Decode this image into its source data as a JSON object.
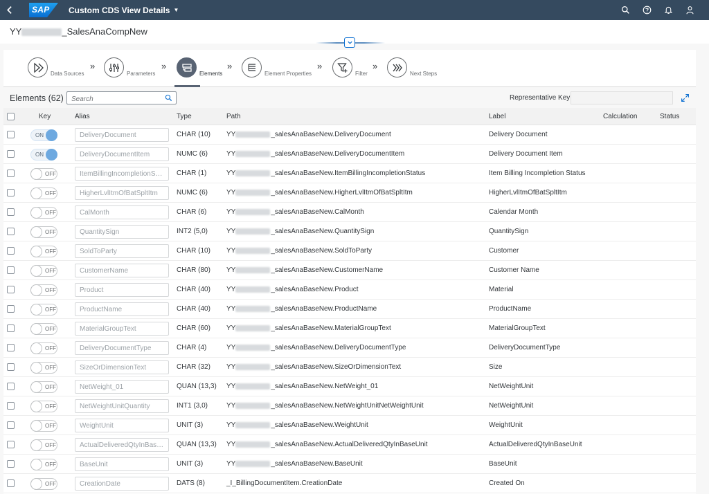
{
  "shell": {
    "logo": "SAP",
    "title": "Custom CDS View Details"
  },
  "header": {
    "title_prefix": "YY",
    "title_suffix": "_SalesAnaCompNew"
  },
  "wizard": {
    "steps": [
      {
        "label": "Data Sources",
        "icon": "data-sources-icon"
      },
      {
        "label": "Parameters",
        "icon": "parameters-icon"
      },
      {
        "label": "Elements",
        "icon": "elements-icon",
        "active": true
      },
      {
        "label": "Element Properties",
        "icon": "element-properties-icon"
      },
      {
        "label": "Filter",
        "icon": "filter-icon"
      },
      {
        "label": "Next Steps",
        "icon": "next-steps-icon"
      }
    ]
  },
  "toolbar": {
    "title": "Elements (62)",
    "search_placeholder": "Search",
    "representative_key_label": "Representative Key"
  },
  "table": {
    "columns": [
      "Key",
      "Alias",
      "Type",
      "Path",
      "Label",
      "Calculation",
      "Status"
    ],
    "toggle_on": "ON",
    "toggle_off": "OFF",
    "rows": [
      {
        "key": true,
        "alias": "DeliveryDocument",
        "type": "CHAR (10)",
        "path_prefix": "YY",
        "path": "_salesAnaBaseNew.DeliveryDocument",
        "label": "Delivery Document"
      },
      {
        "key": true,
        "alias": "DeliveryDocumentItem",
        "type": "NUMC (6)",
        "path_prefix": "YY",
        "path": "_salesAnaBaseNew.DeliveryDocumentItem",
        "label": "Delivery Document Item"
      },
      {
        "key": false,
        "alias": "ItemBillingIncompletionSta...",
        "type": "CHAR (1)",
        "path_prefix": "YY",
        "path": "_salesAnaBaseNew.ItemBillingIncompletionStatus",
        "label": "Item Billing Incompletion Status"
      },
      {
        "key": false,
        "alias": "HigherLvlItmOfBatSpltItm",
        "type": "NUMC (6)",
        "path_prefix": "YY",
        "path": "_salesAnaBaseNew.HigherLvlItmOfBatSpltItm",
        "label": "HigherLvlItmOfBatSpltItm"
      },
      {
        "key": false,
        "alias": "CalMonth",
        "type": "CHAR (6)",
        "path_prefix": "YY",
        "path": "_salesAnaBaseNew.CalMonth",
        "label": "Calendar Month"
      },
      {
        "key": false,
        "alias": "QuantitySign",
        "type": "INT2 (5,0)",
        "path_prefix": "YY",
        "path": "_salesAnaBaseNew.QuantitySign",
        "label": "QuantitySign"
      },
      {
        "key": false,
        "alias": "SoldToParty",
        "type": "CHAR (10)",
        "path_prefix": "YY",
        "path": "_salesAnaBaseNew.SoldToParty",
        "label": "Customer"
      },
      {
        "key": false,
        "alias": "CustomerName",
        "type": "CHAR (80)",
        "path_prefix": "YY",
        "path": "_salesAnaBaseNew.CustomerName",
        "label": "Customer Name"
      },
      {
        "key": false,
        "alias": "Product",
        "type": "CHAR (40)",
        "path_prefix": "YY",
        "path": "_salesAnaBaseNew.Product",
        "label": "Material"
      },
      {
        "key": false,
        "alias": "ProductName",
        "type": "CHAR (40)",
        "path_prefix": "YY",
        "path": "_salesAnaBaseNew.ProductName",
        "label": "ProductName"
      },
      {
        "key": false,
        "alias": "MaterialGroupText",
        "type": "CHAR (60)",
        "path_prefix": "YY",
        "path": "_salesAnaBaseNew.MaterialGroupText",
        "label": "MaterialGroupText"
      },
      {
        "key": false,
        "alias": "DeliveryDocumentType",
        "type": "CHAR (4)",
        "path_prefix": "YY",
        "path": "_salesAnaBaseNew.DeliveryDocumentType",
        "label": "DeliveryDocumentType"
      },
      {
        "key": false,
        "alias": "SizeOrDimensionText",
        "type": "CHAR (32)",
        "path_prefix": "YY",
        "path": "_salesAnaBaseNew.SizeOrDimensionText",
        "label": "Size"
      },
      {
        "key": false,
        "alias": "NetWeight_01",
        "type": "QUAN (13,3)",
        "path_prefix": "YY",
        "path": "_salesAnaBaseNew.NetWeight_01",
        "label": "NetWeightUnit"
      },
      {
        "key": false,
        "alias": "NetWeightUnitQuantity",
        "type": "INT1 (3,0)",
        "path_prefix": "YY",
        "path": "_salesAnaBaseNew.NetWeightUnitNetWeightUnit",
        "label": "NetWeightUnit"
      },
      {
        "key": false,
        "alias": "WeightUnit",
        "type": "UNIT (3)",
        "path_prefix": "YY",
        "path": "_salesAnaBaseNew.WeightUnit",
        "label": "WeightUnit"
      },
      {
        "key": false,
        "alias": "ActualDeliveredQtyInBase...",
        "type": "QUAN (13,3)",
        "path_prefix": "YY",
        "path": "_salesAnaBaseNew.ActualDeliveredQtyInBaseUnit",
        "label": "ActualDeliveredQtyInBaseUnit"
      },
      {
        "key": false,
        "alias": "BaseUnit",
        "type": "UNIT (3)",
        "path_prefix": "YY",
        "path": "_salesAnaBaseNew.BaseUnit",
        "label": "BaseUnit"
      },
      {
        "key": false,
        "alias": "CreationDate",
        "type": "DATS (8)",
        "path_prefix": "",
        "path": "_I_BillingDocumentItem.CreationDate",
        "label": "Created On"
      }
    ]
  }
}
